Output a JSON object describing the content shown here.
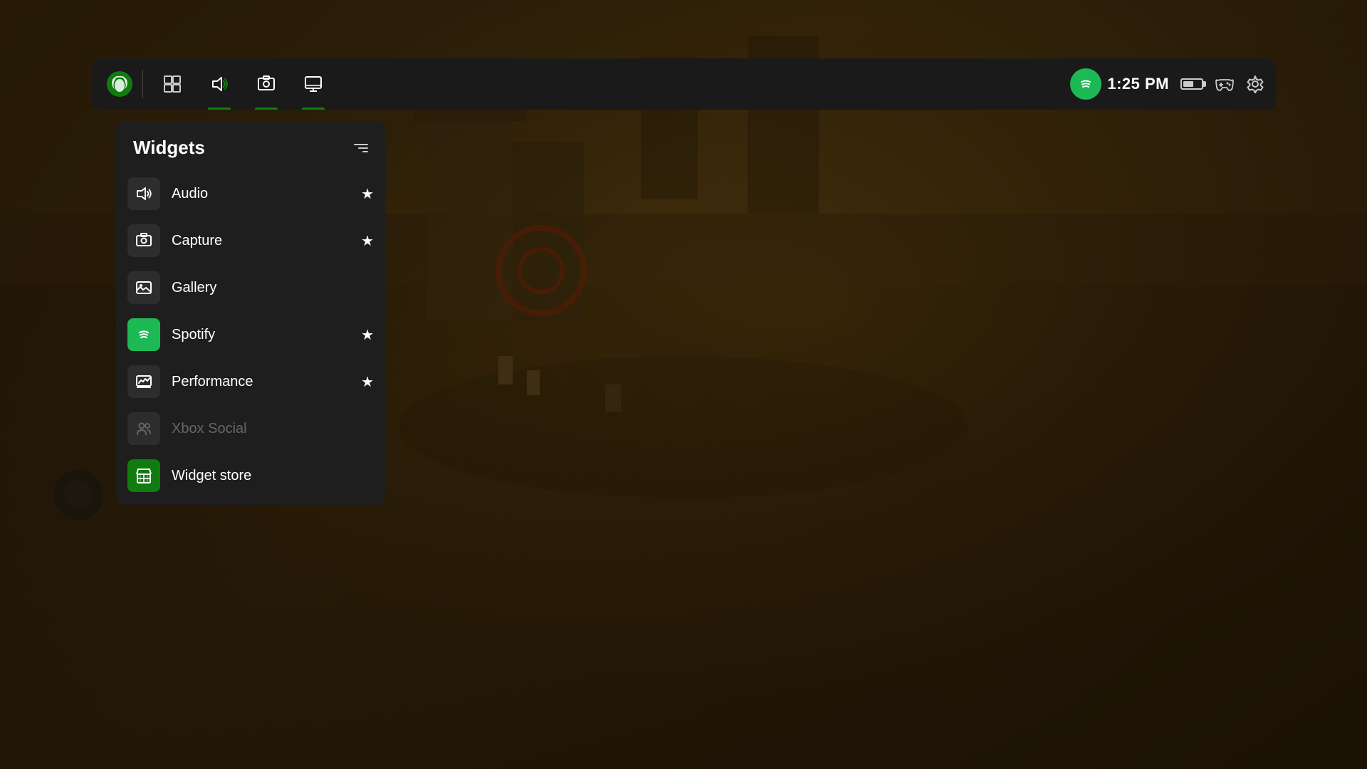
{
  "background": {
    "color": "#1a1008"
  },
  "topbar": {
    "logo": "xbox-logo",
    "nav_items": [
      {
        "id": "multiwindow",
        "icon": "multiwindow-icon",
        "active": false,
        "has_underline": false
      },
      {
        "id": "audio",
        "icon": "audio-icon",
        "active": true,
        "has_underline": true
      },
      {
        "id": "capture",
        "icon": "capture-icon",
        "active": true,
        "has_underline": true
      },
      {
        "id": "display",
        "icon": "display-icon",
        "active": true,
        "has_underline": true
      }
    ],
    "spotify_icon": "spotify-icon",
    "time": "1:25 PM",
    "battery_level": 60,
    "controller_icon": "controller-icon",
    "settings_icon": "gear-icon"
  },
  "widgets_panel": {
    "title": "Widgets",
    "filter_icon": "filter-icon",
    "items": [
      {
        "id": "audio",
        "label": "Audio",
        "icon": "audio-icon",
        "icon_style": "default",
        "starred": true,
        "star_filled": true,
        "enabled": true
      },
      {
        "id": "capture",
        "label": "Capture",
        "icon": "capture-icon",
        "icon_style": "default",
        "starred": true,
        "star_filled": true,
        "enabled": true
      },
      {
        "id": "gallery",
        "label": "Gallery",
        "icon": "gallery-icon",
        "icon_style": "default",
        "starred": false,
        "star_filled": false,
        "enabled": true
      },
      {
        "id": "spotify",
        "label": "Spotify",
        "icon": "spotify-icon",
        "icon_style": "spotify",
        "starred": true,
        "star_filled": true,
        "enabled": true
      },
      {
        "id": "performance",
        "label": "Performance",
        "icon": "performance-icon",
        "icon_style": "default",
        "starred": true,
        "star_filled": true,
        "enabled": true
      },
      {
        "id": "xbox-social",
        "label": "Xbox Social",
        "icon": "social-icon",
        "icon_style": "default",
        "starred": false,
        "star_filled": false,
        "enabled": false
      },
      {
        "id": "widget-store",
        "label": "Widget store",
        "icon": "store-icon",
        "icon_style": "green",
        "starred": false,
        "star_filled": false,
        "enabled": true,
        "no_star": true
      }
    ]
  }
}
